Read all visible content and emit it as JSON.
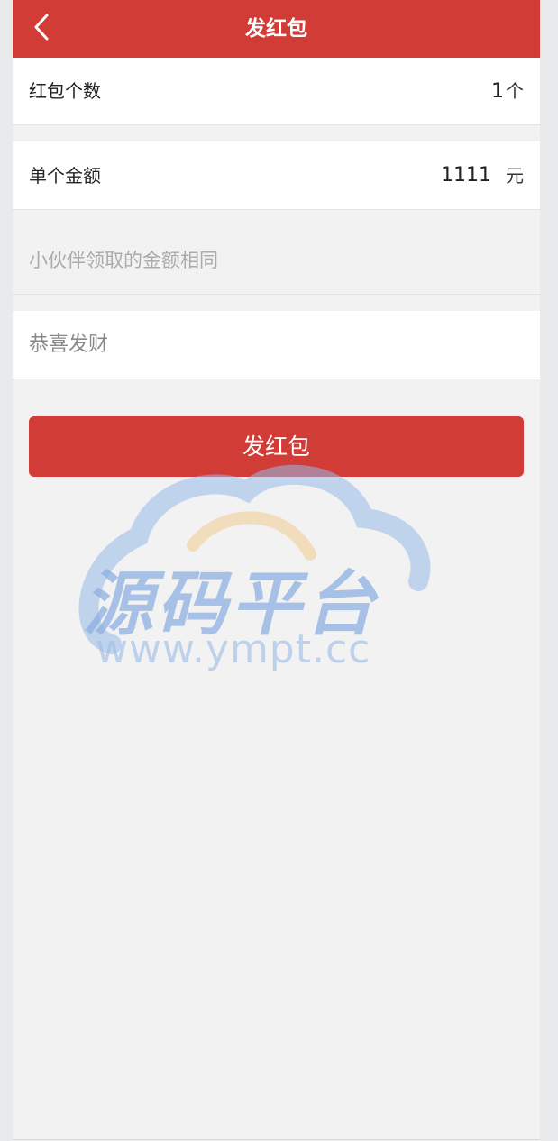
{
  "header": {
    "title": "发红包",
    "back_icon": "chevron-left-icon"
  },
  "count_row": {
    "label": "红包个数",
    "value": "1",
    "unit": "个"
  },
  "amount_row": {
    "label": "单个金额",
    "value": "1111",
    "unit": "元"
  },
  "hint": "小伙伴领取的金额相同",
  "message": {
    "placeholder": "恭喜发财",
    "value": ""
  },
  "send_button": {
    "label": "发红包"
  },
  "watermark": {
    "name": "源码平台",
    "url": "www.ympt.cc"
  },
  "colors": {
    "accent": "#d13d36",
    "background": "#f2f2f2"
  }
}
